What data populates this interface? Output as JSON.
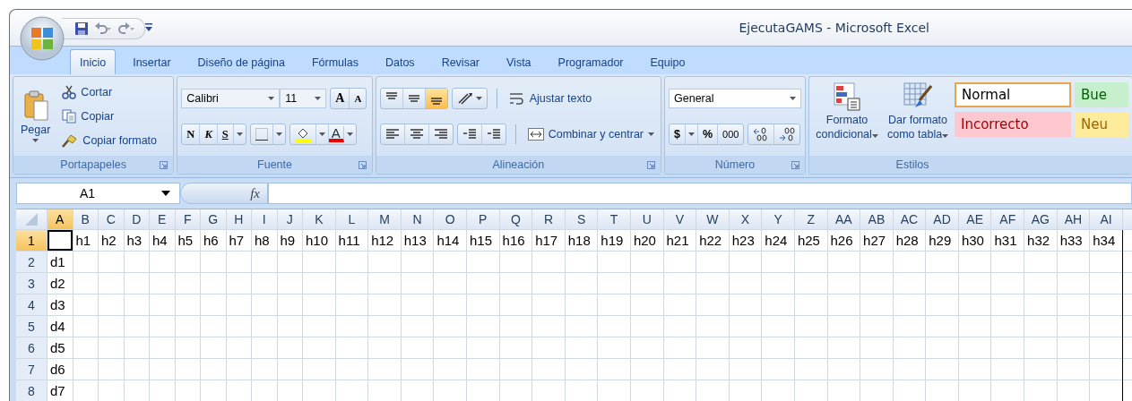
{
  "window": {
    "title": "EjecutaGAMS - Microsoft Excel"
  },
  "tabs": [
    {
      "label": "Inicio",
      "selected": true
    },
    {
      "label": "Insertar",
      "selected": false
    },
    {
      "label": "Diseño de página",
      "selected": false
    },
    {
      "label": "Fórmulas",
      "selected": false
    },
    {
      "label": "Datos",
      "selected": false
    },
    {
      "label": "Revisar",
      "selected": false
    },
    {
      "label": "Vista",
      "selected": false
    },
    {
      "label": "Programador",
      "selected": false
    },
    {
      "label": "Equipo",
      "selected": false
    }
  ],
  "ribbon": {
    "clipboard": {
      "label": "Portapapeles",
      "paste": "Pegar",
      "actions": [
        {
          "kind": "cut",
          "label": "Cortar"
        },
        {
          "kind": "copy",
          "label": "Copiar"
        },
        {
          "kind": "format-painter",
          "label": "Copiar formato"
        }
      ]
    },
    "font": {
      "label": "Fuente",
      "font_name": "Calibri",
      "font_size": "11",
      "grow": "A",
      "shrink": "A",
      "bold": "N",
      "italic": "K",
      "underline": "S",
      "font_color": "A"
    },
    "alignment": {
      "label": "Alineación",
      "vertical_align": [
        {
          "kind": "top",
          "selected": false
        },
        {
          "kind": "middle",
          "selected": false
        },
        {
          "kind": "bottom",
          "selected": true
        }
      ],
      "wrap": "Ajustar texto",
      "merge": "Combinar y centrar"
    },
    "number": {
      "label": "Número",
      "format": "General",
      "currency": "$",
      "percent": "%",
      "thousands": "000"
    },
    "styles": {
      "label": "Estilos",
      "conditional": "Formato condicional",
      "as_table": "Dar formato como tabla",
      "cell_styles": [
        {
          "label": "Normal",
          "kind": "normal",
          "color": "#ffffff",
          "selected": true
        },
        {
          "label": "Bue",
          "kind": "good",
          "color": "#c6efce",
          "selected": false
        },
        {
          "label": "Incorrecto",
          "kind": "bad",
          "color": "#ffc7ce",
          "selected": false
        },
        {
          "label": "Neu",
          "kind": "neutral",
          "color": "#ffeb9c",
          "selected": false
        }
      ]
    }
  },
  "formula_bar": {
    "name_box": "A1",
    "function_label": "fx"
  },
  "sheet": {
    "columns": [
      {
        "label": "A",
        "selected": true
      },
      {
        "label": "B",
        "selected": false
      },
      {
        "label": "C",
        "selected": false
      },
      {
        "label": "D",
        "selected": false
      },
      {
        "label": "E",
        "selected": false
      },
      {
        "label": "F",
        "selected": false
      },
      {
        "label": "G",
        "selected": false
      },
      {
        "label": "H",
        "selected": false
      },
      {
        "label": "I",
        "selected": false
      },
      {
        "label": "J",
        "selected": false
      },
      {
        "label": "K",
        "selected": false
      },
      {
        "label": "L",
        "selected": false
      },
      {
        "label": "M",
        "selected": false
      },
      {
        "label": "N",
        "selected": false
      },
      {
        "label": "O",
        "selected": false
      },
      {
        "label": "P",
        "selected": false
      },
      {
        "label": "Q",
        "selected": false
      },
      {
        "label": "R",
        "selected": false
      },
      {
        "label": "S",
        "selected": false
      },
      {
        "label": "T",
        "selected": false
      },
      {
        "label": "U",
        "selected": false
      },
      {
        "label": "V",
        "selected": false
      },
      {
        "label": "W",
        "selected": false
      },
      {
        "label": "X",
        "selected": false
      },
      {
        "label": "Y",
        "selected": false
      },
      {
        "label": "Z",
        "selected": false
      },
      {
        "label": "AA",
        "selected": false
      },
      {
        "label": "AB",
        "selected": false
      },
      {
        "label": "AC",
        "selected": false
      },
      {
        "label": "AD",
        "selected": false
      },
      {
        "label": "AE",
        "selected": false
      },
      {
        "label": "AF",
        "selected": false
      },
      {
        "label": "AG",
        "selected": false
      },
      {
        "label": "AH",
        "selected": false
      },
      {
        "label": "AI",
        "selected": false
      }
    ],
    "rows": [
      {
        "header": "1",
        "selected": true,
        "cells": [
          "",
          "h1",
          "h2",
          "h3",
          "h4",
          "h5",
          "h6",
          "h7",
          "h8",
          "h9",
          "h10",
          "h11",
          "h12",
          "h13",
          "h14",
          "h15",
          "h16",
          "h17",
          "h18",
          "h19",
          "h20",
          "h21",
          "h22",
          "h23",
          "h24",
          "h25",
          "h26",
          "h27",
          "h28",
          "h29",
          "h30",
          "h31",
          "h32",
          "h33",
          "h34"
        ]
      },
      {
        "header": "2",
        "selected": false,
        "cells": [
          "d1"
        ]
      },
      {
        "header": "3",
        "selected": false,
        "cells": [
          "d2"
        ]
      },
      {
        "header": "4",
        "selected": false,
        "cells": [
          "d3"
        ]
      },
      {
        "header": "5",
        "selected": false,
        "cells": [
          "d4"
        ]
      },
      {
        "header": "6",
        "selected": false,
        "cells": [
          "d5"
        ]
      },
      {
        "header": "7",
        "selected": false,
        "cells": [
          "d6"
        ]
      },
      {
        "header": "8",
        "selected": false,
        "cells": [
          "d7"
        ]
      }
    ]
  }
}
